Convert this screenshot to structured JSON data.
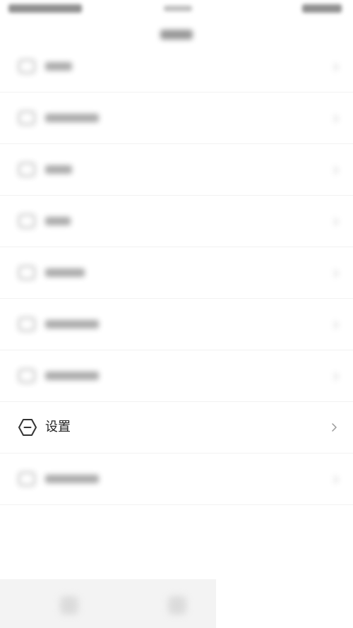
{
  "settings": {
    "label": "设置",
    "icon": "hexagon-minus-icon",
    "chevron": "chevron-right-icon"
  },
  "colors": {
    "background": "#ffffff",
    "text": "#222222",
    "chevron": "#999999",
    "bottom_bar": "#f3f3f3"
  }
}
